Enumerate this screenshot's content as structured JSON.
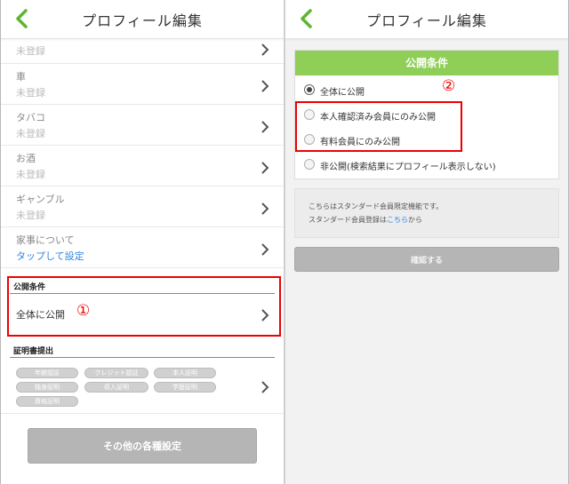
{
  "colors": {
    "accent_green": "#5cb531",
    "card_head": "#8fcf57",
    "highlight_red": "#e00000",
    "link_blue": "#2e86de"
  },
  "left": {
    "title": "プロフィール編集",
    "rows": [
      {
        "label": "",
        "value": "未登録"
      },
      {
        "label": "車",
        "value": "未登録"
      },
      {
        "label": "タバコ",
        "value": "未登録"
      },
      {
        "label": "お酒",
        "value": "未登録"
      },
      {
        "label": "ギャンブル",
        "value": "未登録"
      },
      {
        "label": "家事について",
        "value": "タップして設定"
      }
    ],
    "privacy_section": {
      "header": "公開条件",
      "value": "全体に公開"
    },
    "callout1": "①",
    "certificates": {
      "header": "証明書提出",
      "badges": [
        "年齢認証",
        "クレジット認証",
        "本人証明",
        "独身証明",
        "収入証明",
        "学歴証明",
        "資格証明"
      ]
    },
    "other_settings_button": "その他の各種設定"
  },
  "right": {
    "title": "プロフィール編集",
    "card_title": "公開条件",
    "options": [
      {
        "label": "全体に公開",
        "selected": true
      },
      {
        "label": "本人確認済み会員にのみ公開",
        "selected": false
      },
      {
        "label": "有料会員にのみ公開",
        "selected": false
      },
      {
        "label": "非公開(検索結果にプロフィール表示しない)",
        "selected": false
      }
    ],
    "callout2": "②",
    "note": {
      "line1": "こちらはスタンダード会員限定機能です。",
      "line2_prefix": "スタンダード会員登録は",
      "line2_link": "こちら",
      "line2_suffix": "から"
    },
    "confirm_button": "確認する"
  }
}
